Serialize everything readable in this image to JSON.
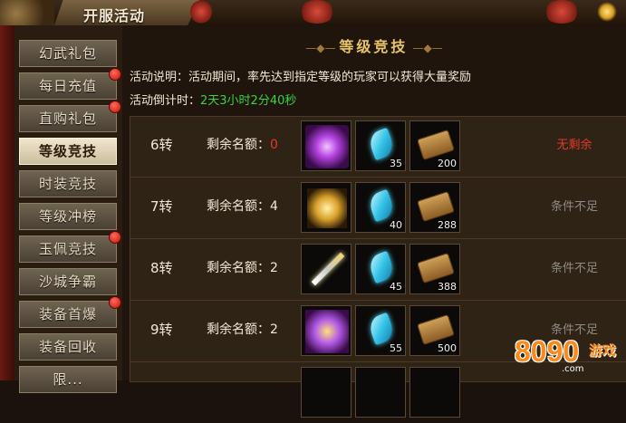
{
  "window": {
    "title": "开服活动"
  },
  "sidebar": {
    "items": [
      {
        "label": "幻武礼包",
        "badge": false,
        "active": false
      },
      {
        "label": "每日充值",
        "badge": true,
        "active": false
      },
      {
        "label": "直购礼包",
        "badge": true,
        "active": false
      },
      {
        "label": "等级竞技",
        "badge": false,
        "active": true
      },
      {
        "label": "时装竞技",
        "badge": false,
        "active": false
      },
      {
        "label": "等级冲榜",
        "badge": false,
        "active": false
      },
      {
        "label": "玉佩竞技",
        "badge": true,
        "active": false
      },
      {
        "label": "沙城争霸",
        "badge": false,
        "active": false
      },
      {
        "label": "装备首爆",
        "badge": true,
        "active": false
      },
      {
        "label": "装备回收",
        "badge": false,
        "active": false
      },
      {
        "label": "限...",
        "badge": false,
        "active": false
      }
    ]
  },
  "main": {
    "title": "等级竞技",
    "description_label": "活动说明：",
    "description": "活动期间，率先达到指定等级的玩家可以获得大量奖励",
    "countdown_label": "活动倒计时：",
    "countdown": "2天3小时2分40秒",
    "quota_label": "剩余名额：",
    "rows": [
      {
        "level": "6转",
        "quota": "0",
        "quota_zero": true,
        "weapon": "weapon-purple",
        "rewards": [
          {
            "icon": "feather-gem-icon",
            "qty": "35"
          },
          {
            "icon": "scroll-icon",
            "qty": "200"
          }
        ],
        "status": "无剩余",
        "status_color": "#e23a2b"
      },
      {
        "level": "7转",
        "quota": "4",
        "quota_zero": false,
        "weapon": "weapon-gold",
        "rewards": [
          {
            "icon": "feather-gem-icon",
            "qty": "40"
          },
          {
            "icon": "scroll-icon",
            "qty": "288"
          }
        ],
        "status": "条件不足",
        "status_color": "#8f8b84"
      },
      {
        "level": "8转",
        "quota": "2",
        "quota_zero": false,
        "weapon": "weapon-sword",
        "rewards": [
          {
            "icon": "feather-gem-icon",
            "qty": "45"
          },
          {
            "icon": "scroll-icon",
            "qty": "388"
          }
        ],
        "status": "条件不足",
        "status_color": "#8f8b84"
      },
      {
        "level": "9转",
        "quota": "2",
        "quota_zero": false,
        "weapon": "weapon-purple2",
        "rewards": [
          {
            "icon": "feather-gem-icon",
            "qty": "55"
          },
          {
            "icon": "scroll-icon",
            "qty": "500"
          }
        ],
        "status": "条件不足",
        "status_color": "#8f8b84"
      }
    ]
  },
  "watermark": {
    "number": "8090",
    "brand": "游戏",
    "domain": ".com"
  }
}
